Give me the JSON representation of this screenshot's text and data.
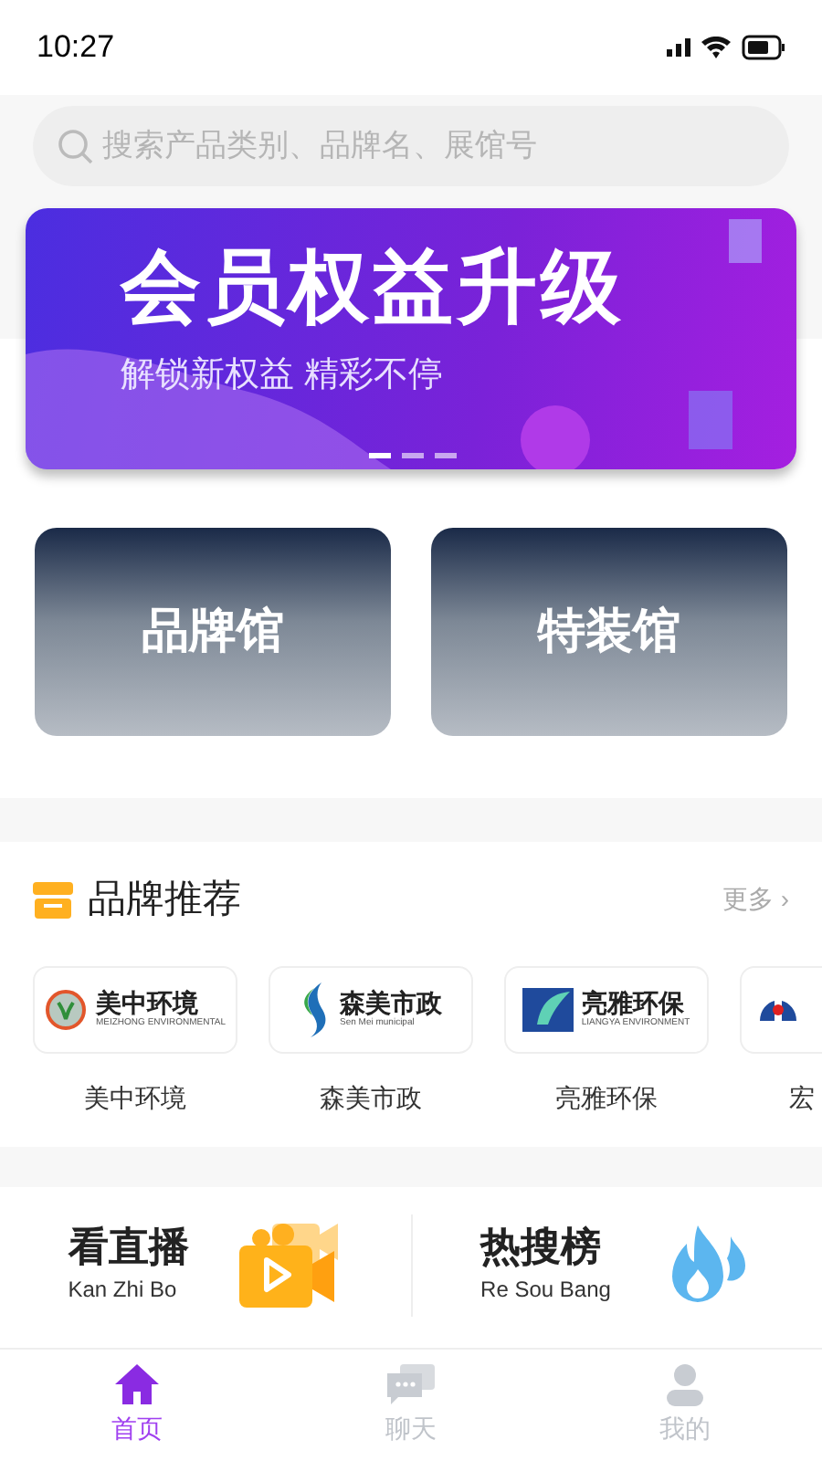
{
  "status_bar": {
    "time": "10:27"
  },
  "search": {
    "placeholder": "搜索产品类别、品牌名、展馆号"
  },
  "banner": {
    "title": "会员权益升级",
    "subtitle": "解锁新权益 精彩不停",
    "dots": [
      {
        "selected": true
      },
      {
        "selected": false
      },
      {
        "selected": false
      }
    ]
  },
  "halls": [
    {
      "label": "品牌馆"
    },
    {
      "label": "特装馆"
    }
  ],
  "brands": {
    "title": "品牌推荐",
    "more": "更多 ›",
    "items": [
      {
        "logo_name": "美中环境",
        "logo_subtitle": "MEIZHONG ENVIRONMENTAL",
        "name": "美中环境",
        "kind": "leaf"
      },
      {
        "logo_name": "森美市政",
        "logo_subtitle": "Sen Mei municipal",
        "name": "森美市政",
        "kind": "wave"
      },
      {
        "logo_name": "亮雅环保",
        "logo_subtitle": "LIANGYA ENVIRONMENT",
        "name": "亮雅环保",
        "kind": "square"
      },
      {
        "name": "宏",
        "kind": "tower"
      }
    ]
  },
  "features": [
    {
      "title": "看直播",
      "subtitle": "Kan Zhi Bo",
      "kind": "video"
    },
    {
      "title": "热搜榜",
      "subtitle": "Re Sou Bang",
      "kind": "fire"
    }
  ],
  "tab_bar": [
    {
      "label": "首页",
      "selected": true,
      "kind": "home"
    },
    {
      "label": "聊天",
      "selected": false,
      "kind": "chat"
    },
    {
      "label": "我的",
      "selected": false,
      "kind": "user"
    }
  ]
}
